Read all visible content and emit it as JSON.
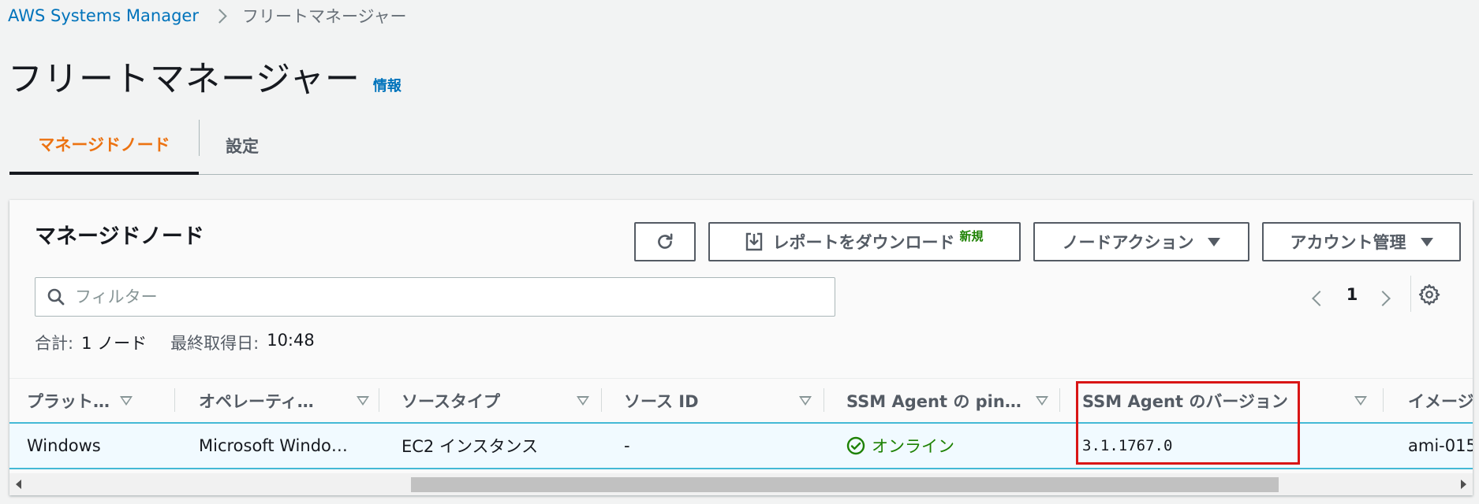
{
  "breadcrumb": {
    "root": "AWS Systems Manager",
    "current": "フリートマネージャー"
  },
  "page": {
    "title": "フリートマネージャー",
    "info": "情報"
  },
  "tabs": [
    {
      "label": "マネージドノード",
      "active": true
    },
    {
      "label": "設定",
      "active": false
    }
  ],
  "panel": {
    "title": "マネージドノード",
    "buttons": {
      "report": "レポートをダウンロード",
      "report_badge": "新規",
      "node_actions": "ノードアクション",
      "account": "アカウント管理"
    },
    "search": {
      "placeholder": "フィルター",
      "value": ""
    },
    "pagination": {
      "current": "1"
    },
    "summary": {
      "total_label": "合計:",
      "total_value": "1 ノード",
      "updated_label": "最終取得日:",
      "updated_value": "10:48"
    }
  },
  "table": {
    "columns": [
      "プラット…",
      "オペレーティ…",
      "ソースタイプ",
      "ソース ID",
      "SSM Agent の pin…",
      "SSM Agent のバージョン",
      "イメージ"
    ],
    "rows": [
      {
        "platform": "Windows",
        "os": "Microsoft Windo…",
        "source_type": "EC2 インスタンス",
        "source_id": "-",
        "ping": "オンライン",
        "agent_version": "3.1.1767.0",
        "image": "ami-015"
      }
    ]
  },
  "colors": {
    "accent": "#ec7211",
    "link": "#0073bb",
    "success": "#1d8102",
    "highlight": "#d91515"
  }
}
